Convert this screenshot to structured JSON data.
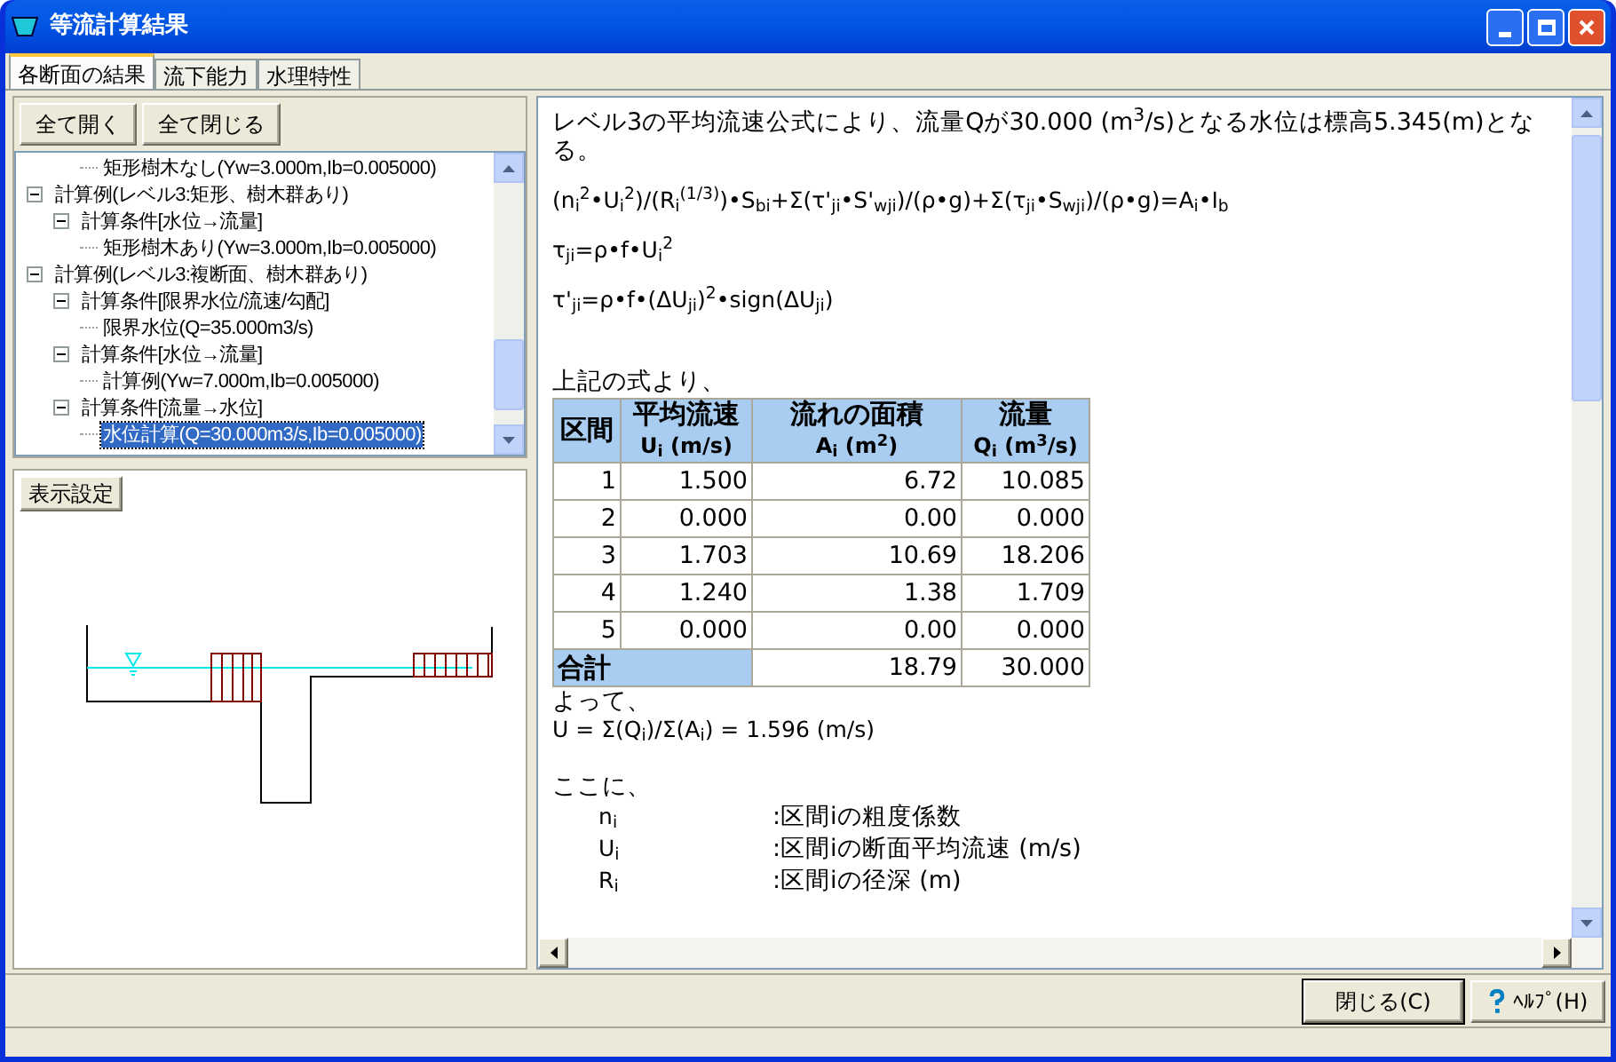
{
  "window": {
    "title": "等流計算結果"
  },
  "tabs": [
    {
      "label": "各断面の結果",
      "selected": true
    },
    {
      "label": "流下能力",
      "selected": false
    },
    {
      "label": "水理特性",
      "selected": false
    }
  ],
  "tree_buttons": [
    "全て開く",
    "全て閉じる"
  ],
  "tree": {
    "items": [
      {
        "children": [
          {
            "children": [
              {
                "label": "矩形樹木なし(Yw=3.000m,Ib=0.005000)",
                "selected": false
              }
            ]
          }
        ]
      },
      {
        "label": "計算例(レベル3:矩形、樹木群あり)",
        "expanded": true,
        "children": [
          {
            "label": "計算条件[水位→流量]",
            "expanded": true,
            "children": [
              {
                "label": "矩形樹木あり(Yw=3.000m,Ib=0.005000)",
                "selected": false
              }
            ]
          }
        ]
      },
      {
        "label": "計算例(レベル3:複断面、樹木群あり)",
        "expanded": true,
        "children": [
          {
            "label": "計算条件[限界水位/流速/勾配]",
            "expanded": true,
            "children": [
              {
                "label": "限界水位(Q=35.000m3/s)",
                "selected": false
              }
            ]
          },
          {
            "label": "計算条件[水位→流量]",
            "expanded": true,
            "children": [
              {
                "label": "計算例(Yw=7.000m,Ib=0.005000)",
                "selected": false
              }
            ]
          },
          {
            "label": "計算条件[流量→水位]",
            "expanded": true,
            "children": [
              {
                "label": "水位計算(Q=30.000m3/s,Ib=0.005000)",
                "selected": true
              }
            ]
          }
        ]
      }
    ]
  },
  "display_button": "表示設定",
  "result": {
    "intro": "レベル3の平均流速公式により、流量Qが30.000 (m$^{3}$/s)となる水位は標高5.345(m)となる。",
    "formulas": [
      "(n$_{i}$$^{2}$•U$_{i}$$^{2}$)/(R$_{i}$$^{(1/3)}$)•S$_{bi}$+Σ(τ'$_{ji}$•S'$_{wji}$)/(ρ•g)+Σ(τ$_{ji}$•S$_{wji}$)/(ρ•g)=A$_{i}$•I$_{b}$",
      "τ$_{ji}$=ρ•f•U$_{i}$$^{2}$",
      "τ'$_{ji}$=ρ•f•(ΔU$_{ji}$)$^{2}$•sign(ΔU$_{ji}$)"
    ],
    "table_intro": "上記の式より、",
    "table": {
      "columns": [
        {
          "title": "区間"
        },
        {
          "title": "平均流速",
          "unit": "U$_{i}$ (m/s)"
        },
        {
          "title": "流れの面積",
          "unit": "A$_{i}$ (m$^{2}$)"
        },
        {
          "title": "流量",
          "unit": "Q$_{i}$ (m$^{3}$/s)"
        }
      ],
      "rows": [
        [
          "1",
          "1.500",
          "6.72",
          "10.085"
        ],
        [
          "2",
          "0.000",
          "0.00",
          "0.000"
        ],
        [
          "3",
          "1.703",
          "10.69",
          "18.206"
        ],
        [
          "4",
          "1.240",
          "1.38",
          "1.709"
        ],
        [
          "5",
          "0.000",
          "0.00",
          "0.000"
        ]
      ],
      "total": {
        "label": "合計",
        "area": "18.79",
        "flow": "30.000"
      }
    },
    "conclusion": "よって、",
    "mean_formula": "U = Σ(Q$_{i}$)/Σ(A$_{i}$) = 1.596 (m/s)",
    "where": "ここに、",
    "definitions": [
      {
        "symbol": "n$_{i}$",
        "text": ":区間iの粗度係数"
      },
      {
        "symbol": "U$_{i}$",
        "text": ":区間iの断面平均流速 (m/s)"
      },
      {
        "symbol": "R$_{i}$",
        "text": ":区間iの径深 (m)"
      }
    ]
  },
  "footer_buttons": [
    {
      "label": "閉じる(C)",
      "kind": "default"
    },
    {
      "label": "ﾍﾙﾌﾟ(H)",
      "kind": "help"
    }
  ]
}
